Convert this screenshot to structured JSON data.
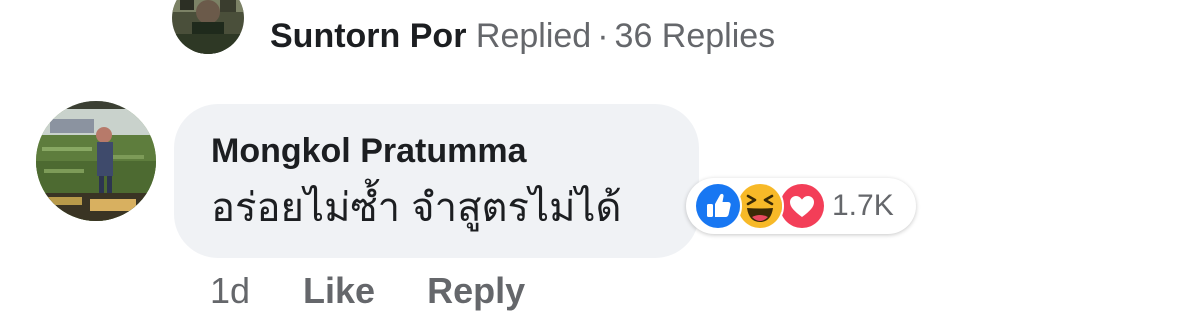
{
  "replies_summary": {
    "name": "Suntorn Por",
    "action": "Replied",
    "separator": "·",
    "count_text": "36 Replies"
  },
  "comment": {
    "author": "Mongkol Pratumma",
    "text": "อร่อยไม่ซ้ำ จำสูตรไม่ได้",
    "reactions": {
      "icons": [
        "like-icon",
        "haha-icon",
        "love-icon"
      ],
      "count": "1.7K"
    },
    "timestamp": "1d",
    "like_label": "Like",
    "reply_label": "Reply"
  },
  "colors": {
    "bubble_bg": "#f0f2f5",
    "text_primary": "#1c1e21",
    "text_secondary": "#65676b",
    "like_blue": "#1877f2",
    "haha_yellow": "#f7b928",
    "love_red": "#f33e58"
  }
}
